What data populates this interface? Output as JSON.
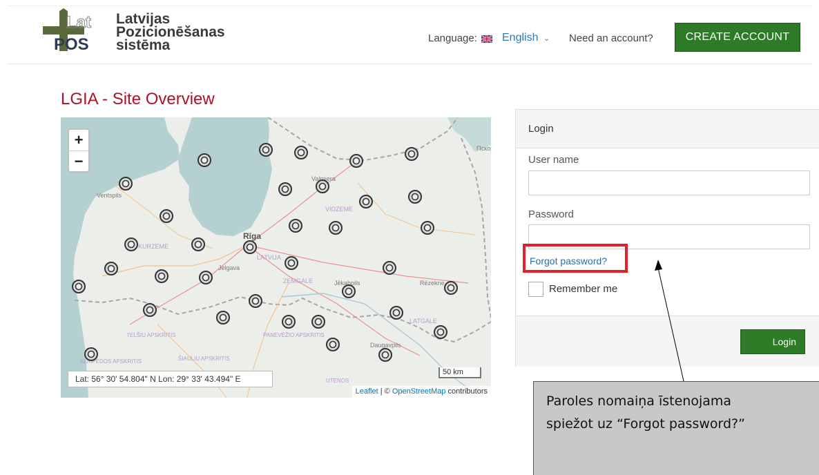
{
  "header": {
    "logo_lines": [
      "Latvijas",
      "Pozicionēšanas",
      "sistēma"
    ],
    "logo_mark": "LatPOS",
    "language_label": "Language:",
    "language_value": "English",
    "need_account": "Need an account?",
    "create_account": "CREATE ACCOUNT"
  },
  "page": {
    "title": "LGIA - Site Overview"
  },
  "map": {
    "zoom_in": "+",
    "zoom_out": "−",
    "scale": "50 km",
    "coords": "Lat: 56° 30' 54.804\" N Lon: 29° 33' 43.494\" E",
    "attribution_leaflet": "Leaflet",
    "attribution_sep": " | © ",
    "attribution_osm": "OpenStreetMap",
    "attribution_tail": " contributors",
    "place_labels": [
      "Ventspils",
      "Valmiera",
      "VIDZEME",
      "Rīga",
      "KURZEME",
      "Jelgava",
      "LATVIJA",
      "ZEMGALE",
      "Jēkabpils",
      "Rēzekne",
      "LATGALE",
      "TELŠIU APSKRITIS",
      "PANEVĖŽIO APSKRITIS",
      "ŠIAULIU APSKRITIS",
      "KLAIPĖDOS APSKRITIS",
      "Daugavpils",
      "UTENOS",
      "Псков"
    ],
    "marker_count": 36
  },
  "login": {
    "panel_title": "Login",
    "username_label": "User name",
    "username_value": "",
    "password_label": "Password",
    "password_value": "",
    "forgot": "Forgot password?",
    "remember": "Remember me",
    "submit": "Login"
  },
  "callout": {
    "line1": "Paroles nomaiņa īstenojama",
    "line2": "spiežot uz “Forgot password?”"
  },
  "colors": {
    "accent_green": "#2d7a27",
    "title_red": "#b1102c",
    "highlight_red": "#e0212b",
    "link_blue": "#2a6ea6"
  },
  "icons": {
    "user": "user-icon",
    "lock": "lock-icon",
    "flag": "uk-flag-icon",
    "caret": "chevron-down-icon"
  }
}
